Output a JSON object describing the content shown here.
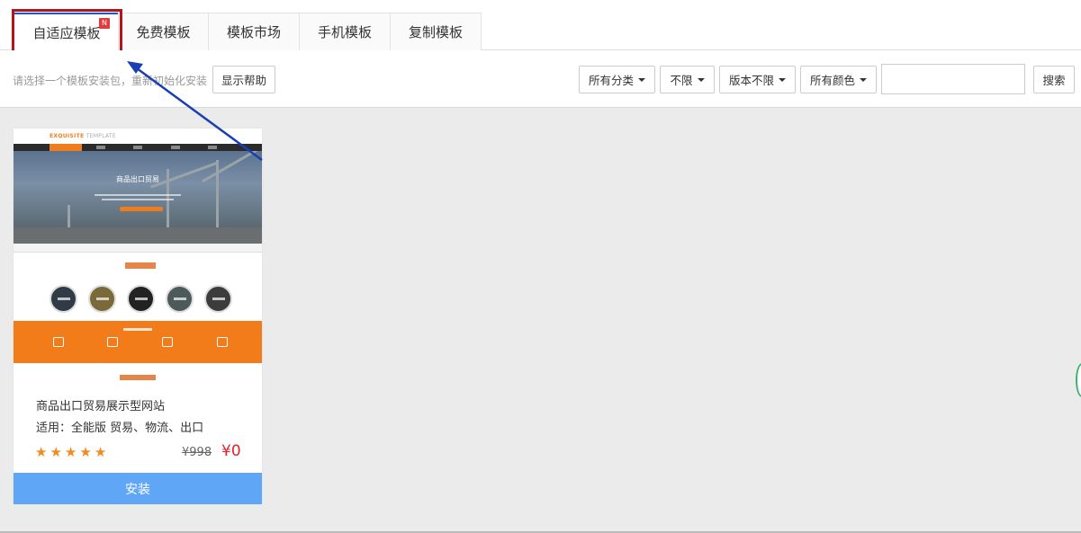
{
  "tabs": [
    {
      "label": "自适应模板",
      "badge": "N",
      "active": true
    },
    {
      "label": "免费模板"
    },
    {
      "label": "模板市场"
    },
    {
      "label": "手机模板"
    },
    {
      "label": "复制模板"
    }
  ],
  "toolbar": {
    "hint": "请选择一个模板安装包，重新初始化安装",
    "help_button": "显示帮助",
    "filters": [
      {
        "label": "所有分类"
      },
      {
        "label": "不限"
      },
      {
        "label": "版本不限"
      },
      {
        "label": "所有颜色"
      }
    ],
    "search_value": "",
    "search_button": "搜索"
  },
  "card": {
    "thumbnail": {
      "logo_main": "EXQUISITE",
      "logo_sub": "TEMPLATE",
      "hero_title": "商品出口贸易"
    },
    "title": "商品出口贸易展示型网站",
    "tags": "适用：全能版 贸易、物流、出口",
    "rating": 5,
    "old_price": "¥998",
    "price": "¥0",
    "install_button": "安装"
  },
  "colors": {
    "accent_blue": "#1a59c9",
    "highlight_red": "#b3151b",
    "install_blue": "#5fa6f7",
    "price_red": "#e4202c",
    "star_orange": "#f28a1e",
    "thumb_orange": "#f27b1a"
  },
  "icons": [
    "caret-down-icon",
    "star-icon",
    "annotation-arrow-icon"
  ]
}
